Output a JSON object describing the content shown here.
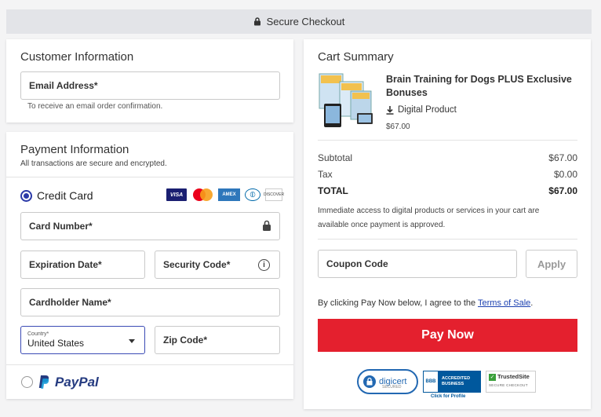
{
  "header": {
    "title": "Secure Checkout"
  },
  "customer": {
    "title": "Customer Information",
    "email_label": "Email Address*",
    "email_hint": "To receive an email order confirmation."
  },
  "payment": {
    "title": "Payment Information",
    "subtitle": "All transactions are secure and encrypted.",
    "credit_card_label": "Credit Card",
    "card_brands": [
      "VISA",
      "Mastercard",
      "AMEX",
      "Diners",
      "DISCOVER"
    ],
    "card_number_label": "Card Number*",
    "expiration_label": "Expiration Date*",
    "security_code_label": "Security Code*",
    "cardholder_label": "Cardholder Name*",
    "country_label": "Country*",
    "country_value": "United States",
    "zip_label": "Zip Code*",
    "paypal_label": "PayPal"
  },
  "cart": {
    "title": "Cart Summary",
    "product_title": "Brain Training for Dogs PLUS Exclusive Bonuses",
    "product_type": "Digital Product",
    "product_price": "$67.00",
    "subtotal_label": "Subtotal",
    "subtotal_value": "$67.00",
    "tax_label": "Tax",
    "tax_value": "$0.00",
    "total_label": "TOTAL",
    "total_value": "$67.00",
    "note": "Immediate access to digital products or services in your cart are available once payment is approved.",
    "coupon_label": "Coupon Code",
    "apply_label": "Apply",
    "terms_prefix": "By clicking Pay Now below, I agree to the ",
    "terms_link": "Terms of Sale",
    "terms_suffix": ".",
    "pay_now_label": "Pay Now"
  },
  "badges": {
    "digicert": "digicert",
    "digicert_sub": "SECURED",
    "bbb_logo": "BBB",
    "bbb_text_1": "ACCREDITED",
    "bbb_text_2": "BUSINESS",
    "bbb_caption": "Click for Profile",
    "trustedsite": "TrustedSite",
    "trustedsite_sub": "SECURE CHECKOUT"
  },
  "colors": {
    "accent": "#2b3aa8",
    "pay_button": "#e4202e",
    "link": "#1a3fb0"
  }
}
